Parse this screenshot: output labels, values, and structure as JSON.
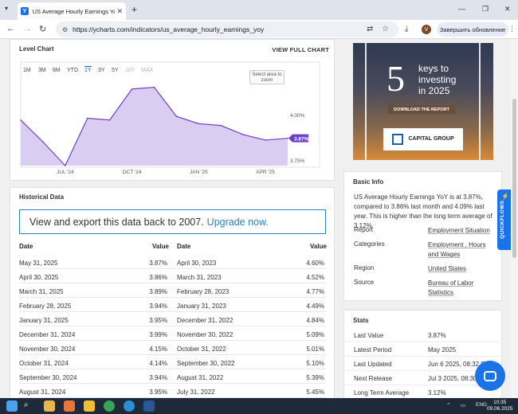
{
  "browser": {
    "tab_title": "US Average Hourly Earnings YoY | ",
    "tab_favicon": "Y",
    "url": "https://ycharts.com/indicators/us_average_hourly_earnings_yoy",
    "profile_initial": "V",
    "update_button": "Завершить обновление"
  },
  "chart": {
    "title": "Level Chart",
    "view_full": "VIEW FULL CHART",
    "ranges": [
      "1M",
      "3M",
      "6M",
      "YTD",
      "1Y",
      "3Y",
      "5Y",
      "10Y",
      "MAX"
    ],
    "active_range": "1Y",
    "zoom_hint": "Select area to zoom",
    "y_ticks": [
      "4.00%",
      "3.75%"
    ],
    "x_ticks": [
      "JUL '24",
      "OCT '24",
      "JAN '25",
      "APR '25"
    ],
    "last_value_label": "3.87%",
    "accent_color": "#6f3fc9",
    "fill_color": "#d9cdf2"
  },
  "chart_data": {
    "type": "area",
    "title": "Level Chart",
    "x": [
      "2024-05",
      "2024-06",
      "2024-07",
      "2024-08",
      "2024-09",
      "2024-10",
      "2024-11",
      "2024-12",
      "2025-01",
      "2025-02",
      "2025-03",
      "2025-04",
      "2025-05"
    ],
    "y": [
      3.97,
      3.85,
      3.72,
      3.98,
      3.97,
      4.14,
      4.15,
      3.99,
      3.95,
      3.94,
      3.89,
      3.86,
      3.87
    ],
    "ylim": [
      3.72,
      4.17
    ],
    "ylabel": "",
    "xlabel": "",
    "grid": false
  },
  "historical": {
    "title": "Historical Data",
    "banner_text": "View and export this data back to 2007.",
    "banner_link": "Upgrade now.",
    "col_date": "Date",
    "col_value": "Value",
    "left_rows": [
      {
        "date": "May 31, 2025",
        "value": "3.87%"
      },
      {
        "date": "April 30, 2025",
        "value": "3.86%"
      },
      {
        "date": "March 31, 2025",
        "value": "3.89%"
      },
      {
        "date": "February 28, 2025",
        "value": "3.94%"
      },
      {
        "date": "January 31, 2025",
        "value": "3.95%"
      },
      {
        "date": "December 31, 2024",
        "value": "3.99%"
      },
      {
        "date": "November 30, 2024",
        "value": "4.15%"
      },
      {
        "date": "October 31, 2024",
        "value": "4.14%"
      },
      {
        "date": "September 30, 2024",
        "value": "3.94%"
      },
      {
        "date": "August 31, 2024",
        "value": "3.95%"
      }
    ],
    "right_rows": [
      {
        "date": "April 30, 2023",
        "value": "4.60%"
      },
      {
        "date": "March 31, 2023",
        "value": "4.52%"
      },
      {
        "date": "February 28, 2023",
        "value": "4.77%"
      },
      {
        "date": "January 31, 2023",
        "value": "4.49%"
      },
      {
        "date": "December 31, 2022",
        "value": "4.84%"
      },
      {
        "date": "November 30, 2022",
        "value": "5.09%"
      },
      {
        "date": "October 31, 2022",
        "value": "5.01%"
      },
      {
        "date": "September 30, 2022",
        "value": "5.10%"
      },
      {
        "date": "August 31, 2022",
        "value": "5.39%"
      },
      {
        "date": "July 31, 2022",
        "value": "5.45%"
      }
    ]
  },
  "ad": {
    "number": "5",
    "line1": "keys to",
    "line2": "investing",
    "line3": "in 2025",
    "button": "DOWNLOAD THE REPORT",
    "brand": "CAPITAL GROUP"
  },
  "basic_info": {
    "title": "Basic Info",
    "summary": "US Average Hourly Earnings YoY is at 3.87%, compared to 3.86% last month and 4.09% last year. This is higher than the long term average of 3.12%.",
    "report_label": "Report",
    "report_value": "Employment Situation",
    "categories_label": "Categories",
    "categories_value": "Employment , Hours and Wages",
    "region_label": "Region",
    "region_value": "United States",
    "source_label": "Source",
    "source_value": "Bureau of Labor Statistics"
  },
  "stats": {
    "title": "Stats",
    "rows": [
      {
        "label": "Last Value",
        "value": "3.87%"
      },
      {
        "label": "Latest Period",
        "value": "May 2025"
      },
      {
        "label": "Last Updated",
        "value": "Jun 6 2025, 08:32 EDT"
      },
      {
        "label": "Next Release",
        "value": "Jul 3 2025, 08:30 E"
      },
      {
        "label": "Long Term Average",
        "value": "3.12%"
      }
    ]
  },
  "quickflows": "QUICKFLOWS",
  "taskbar": {
    "lang": "ENG",
    "time": "10:35",
    "date": "09.06.2025"
  }
}
